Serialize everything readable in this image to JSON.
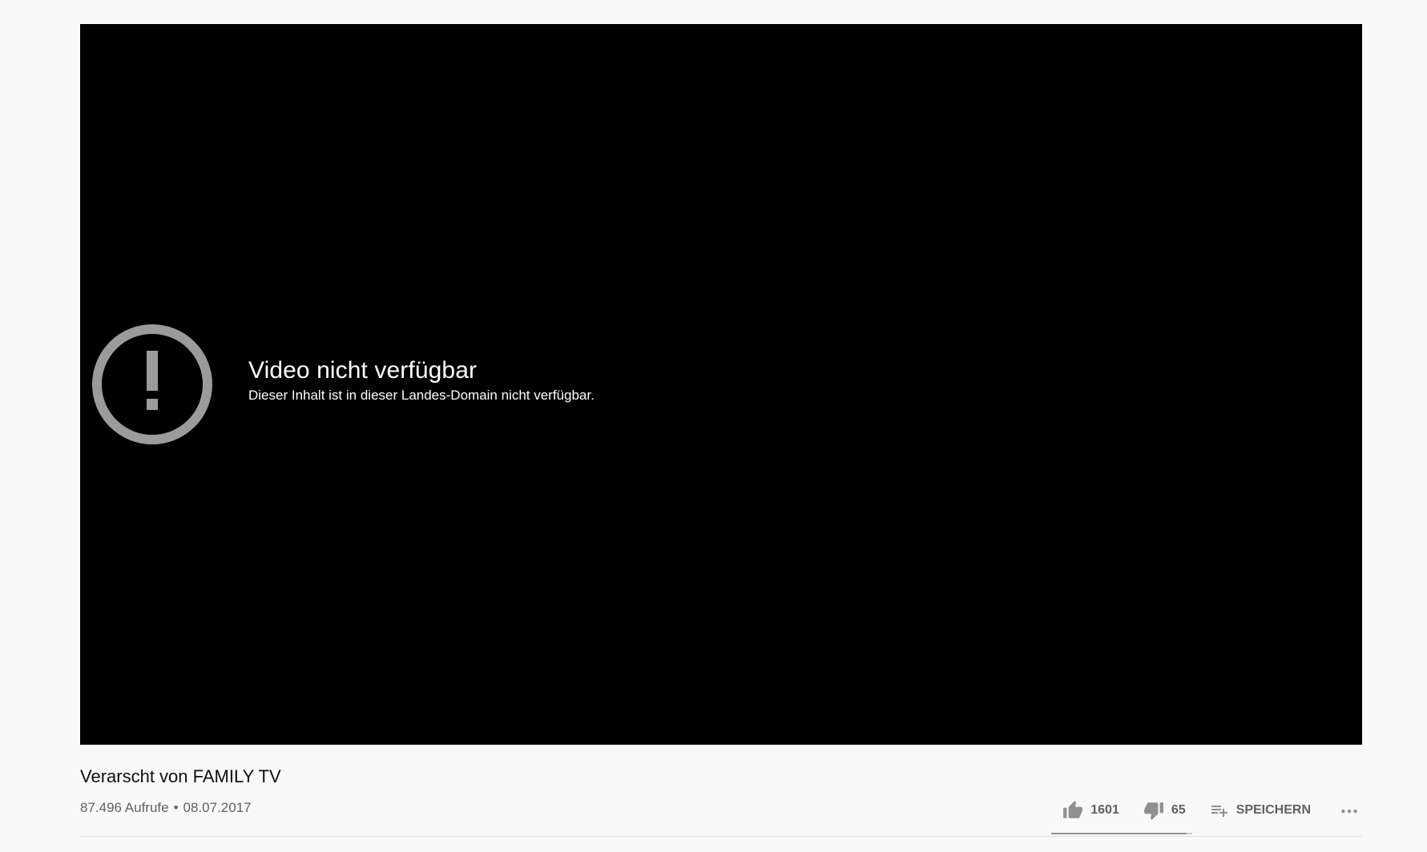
{
  "player": {
    "error_title": "Video nicht verfügbar",
    "error_message": "Dieser Inhalt ist in dieser Landes-Domain nicht verfügbar.",
    "error_icon": "alert-circle-icon"
  },
  "video": {
    "title": "Verarscht von FAMILY TV",
    "views": "87.496 Aufrufe",
    "separator": "•",
    "date": "08.07.2017"
  },
  "actions": {
    "like_count": "1601",
    "dislike_count": "65",
    "save_label": "SPEICHERN",
    "more_icon": "more-horizontal-icon",
    "like_ratio": 0.961
  },
  "colors": {
    "background": "#f9f9f9",
    "player": "#000000",
    "icon_gray": "#909090",
    "meta_text": "#606060"
  }
}
